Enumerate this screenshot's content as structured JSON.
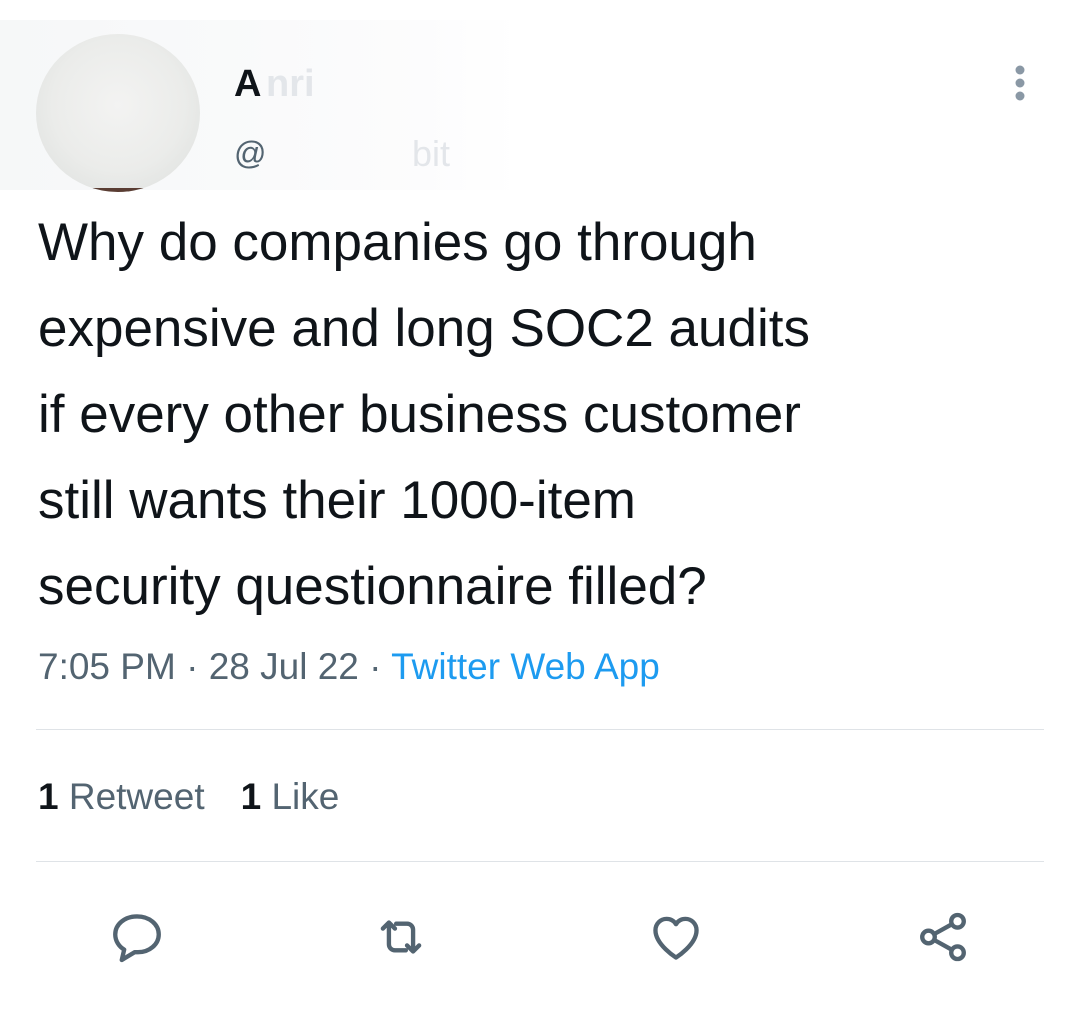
{
  "author": {
    "name_visible": "A",
    "name_faded": "nri",
    "handle_prefix": "@",
    "handle_faded": "bit"
  },
  "tweet": {
    "text": "Why do companies go through\nexpensive and long SOC2 audits\nif every other business customer\nstill wants their 1000-item\nsecurity questionnaire filled?",
    "time": "7:05 PM",
    "separator": " · ",
    "date": "28 Jul 22",
    "source": "Twitter Web App"
  },
  "stats": {
    "retweet_count": "1",
    "retweet_label": "Retweet",
    "like_count": "1",
    "like_label": "Like"
  },
  "icons": {
    "more": "more-vertical-icon",
    "reply": "reply-icon",
    "retweet": "retweet-icon",
    "like": "heart-icon",
    "share": "share-icon"
  },
  "colors": {
    "text": "#0f1419",
    "secondary": "#536471",
    "link": "#1d9bf0",
    "divider": "#dfe3e7"
  }
}
